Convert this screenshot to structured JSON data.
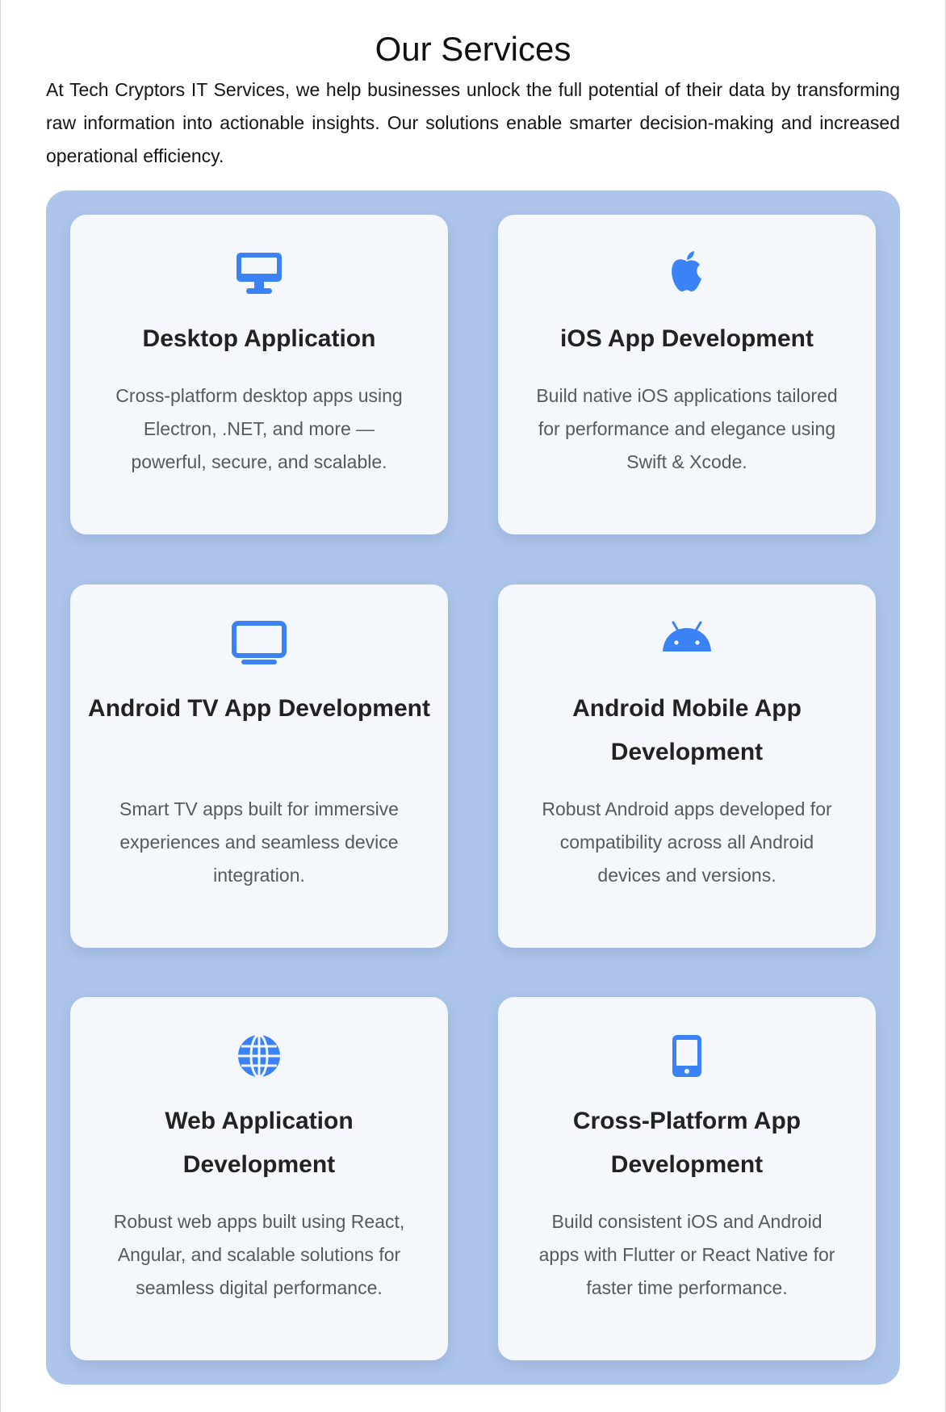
{
  "section": {
    "title": "Our Services",
    "intro": "At Tech Cryptors IT Services, we help businesses unlock the full potential of their data by transforming raw information into actionable insights. Our solutions enable smarter decision-making and increased operational efficiency."
  },
  "colors": {
    "accent": "#3b82f6",
    "panel_background": "#adc5ea",
    "card_background": "#f4f7fb",
    "heading_text": "#222222",
    "body_text": "#555a60"
  },
  "services": [
    {
      "icon": "desktop-icon",
      "title": "Desktop Application",
      "description": "Cross-platform desktop apps using Electron, .NET, and more — powerful, secure, and scalable."
    },
    {
      "icon": "apple-icon",
      "title": "iOS App Development",
      "description": "Build native iOS applications tailored for performance and elegance using Swift & Xcode."
    },
    {
      "icon": "tv-icon",
      "title": "Android TV App Development",
      "description": "Smart TV apps built for immersive experiences and seamless device integration."
    },
    {
      "icon": "android-icon",
      "title": "Android Mobile App Development",
      "description": "Robust Android apps developed for compatibility across all Android devices and versions."
    },
    {
      "icon": "globe-icon",
      "title": "Web Application Development",
      "description": "Robust web apps built using React, Angular, and scalable solutions for seamless digital performance."
    },
    {
      "icon": "mobile-phone-icon",
      "title": "Cross-Platform App Development",
      "description": "Build consistent iOS and Android apps with Flutter or React Native for faster time performance."
    }
  ]
}
